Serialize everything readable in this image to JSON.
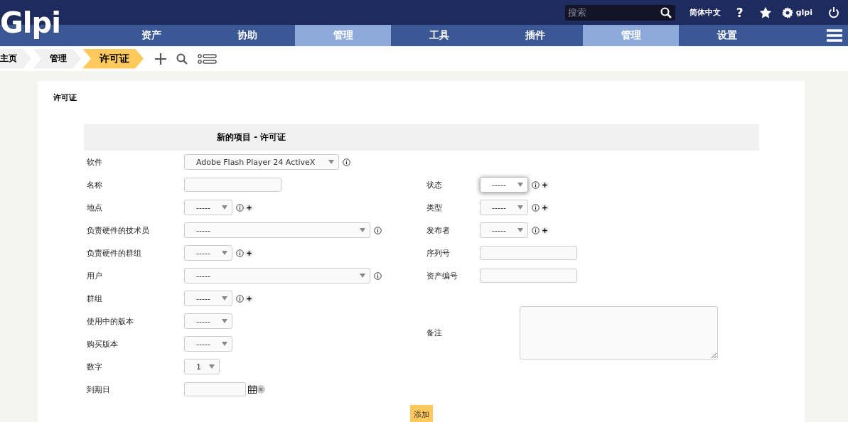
{
  "top_bar": {
    "search": {
      "placeholder": "搜索"
    },
    "language": "简体中文",
    "help": "?",
    "user": "glpi"
  },
  "logo": "Glpi",
  "menu": [
    {
      "label": "资产",
      "selected": false
    },
    {
      "label": "协助",
      "selected": false
    },
    {
      "label": "管理",
      "selected": true
    },
    {
      "label": "工具",
      "selected": false
    },
    {
      "label": "插件",
      "selected": false
    },
    {
      "label": "管理",
      "selected": true
    },
    {
      "label": "设置",
      "selected": false
    }
  ],
  "breadcrumb": [
    {
      "label": "主页",
      "selected": false
    },
    {
      "label": "管理",
      "selected": false
    },
    {
      "label": "许可证",
      "selected": true
    }
  ],
  "card_title": "许可证",
  "form": {
    "title": "新的项目 - 许可证",
    "left": [
      {
        "kind": "wideselect",
        "label": "软件",
        "value": "Adobe Flash Player 24 ActiveX",
        "info": true,
        "add": false
      },
      {
        "kind": "text",
        "label": "名称"
      },
      {
        "kind": "select",
        "label": "地点",
        "value": "-----",
        "info": true,
        "add": true
      },
      {
        "kind": "longselect",
        "label": "负责硬件的技术员",
        "value": "-----",
        "info": true,
        "add": false
      },
      {
        "kind": "select",
        "label": "负责硬件的群组",
        "value": "-----",
        "info": true,
        "add": true
      },
      {
        "kind": "longselect",
        "label": "用户",
        "value": "-----",
        "info": true,
        "add": false
      },
      {
        "kind": "select",
        "label": "群组",
        "value": "-----",
        "info": true,
        "add": true
      },
      {
        "kind": "select",
        "label": "使用中的版本",
        "value": "-----",
        "info": false,
        "add": false
      },
      {
        "kind": "select",
        "label": "购买版本",
        "value": "-----",
        "info": false,
        "add": false
      },
      {
        "kind": "tinyselect",
        "label": "数字",
        "value": "1",
        "info": false,
        "add": false
      },
      {
        "kind": "date",
        "label": "到期日"
      }
    ],
    "right": [
      {
        "kind": "select",
        "label": "状态",
        "value": "-----",
        "info": true,
        "add": true,
        "focused": true
      },
      {
        "kind": "select",
        "label": "类型",
        "value": "-----",
        "info": true,
        "add": true,
        "focused": false
      },
      {
        "kind": "select",
        "label": "发布者",
        "value": "-----",
        "info": true,
        "add": true,
        "focused": false
      },
      {
        "kind": "text",
        "label": "序列号"
      },
      {
        "kind": "text",
        "label": "资产编号"
      },
      {
        "kind": "notes",
        "label": "备注"
      }
    ],
    "submit": "添加"
  }
}
